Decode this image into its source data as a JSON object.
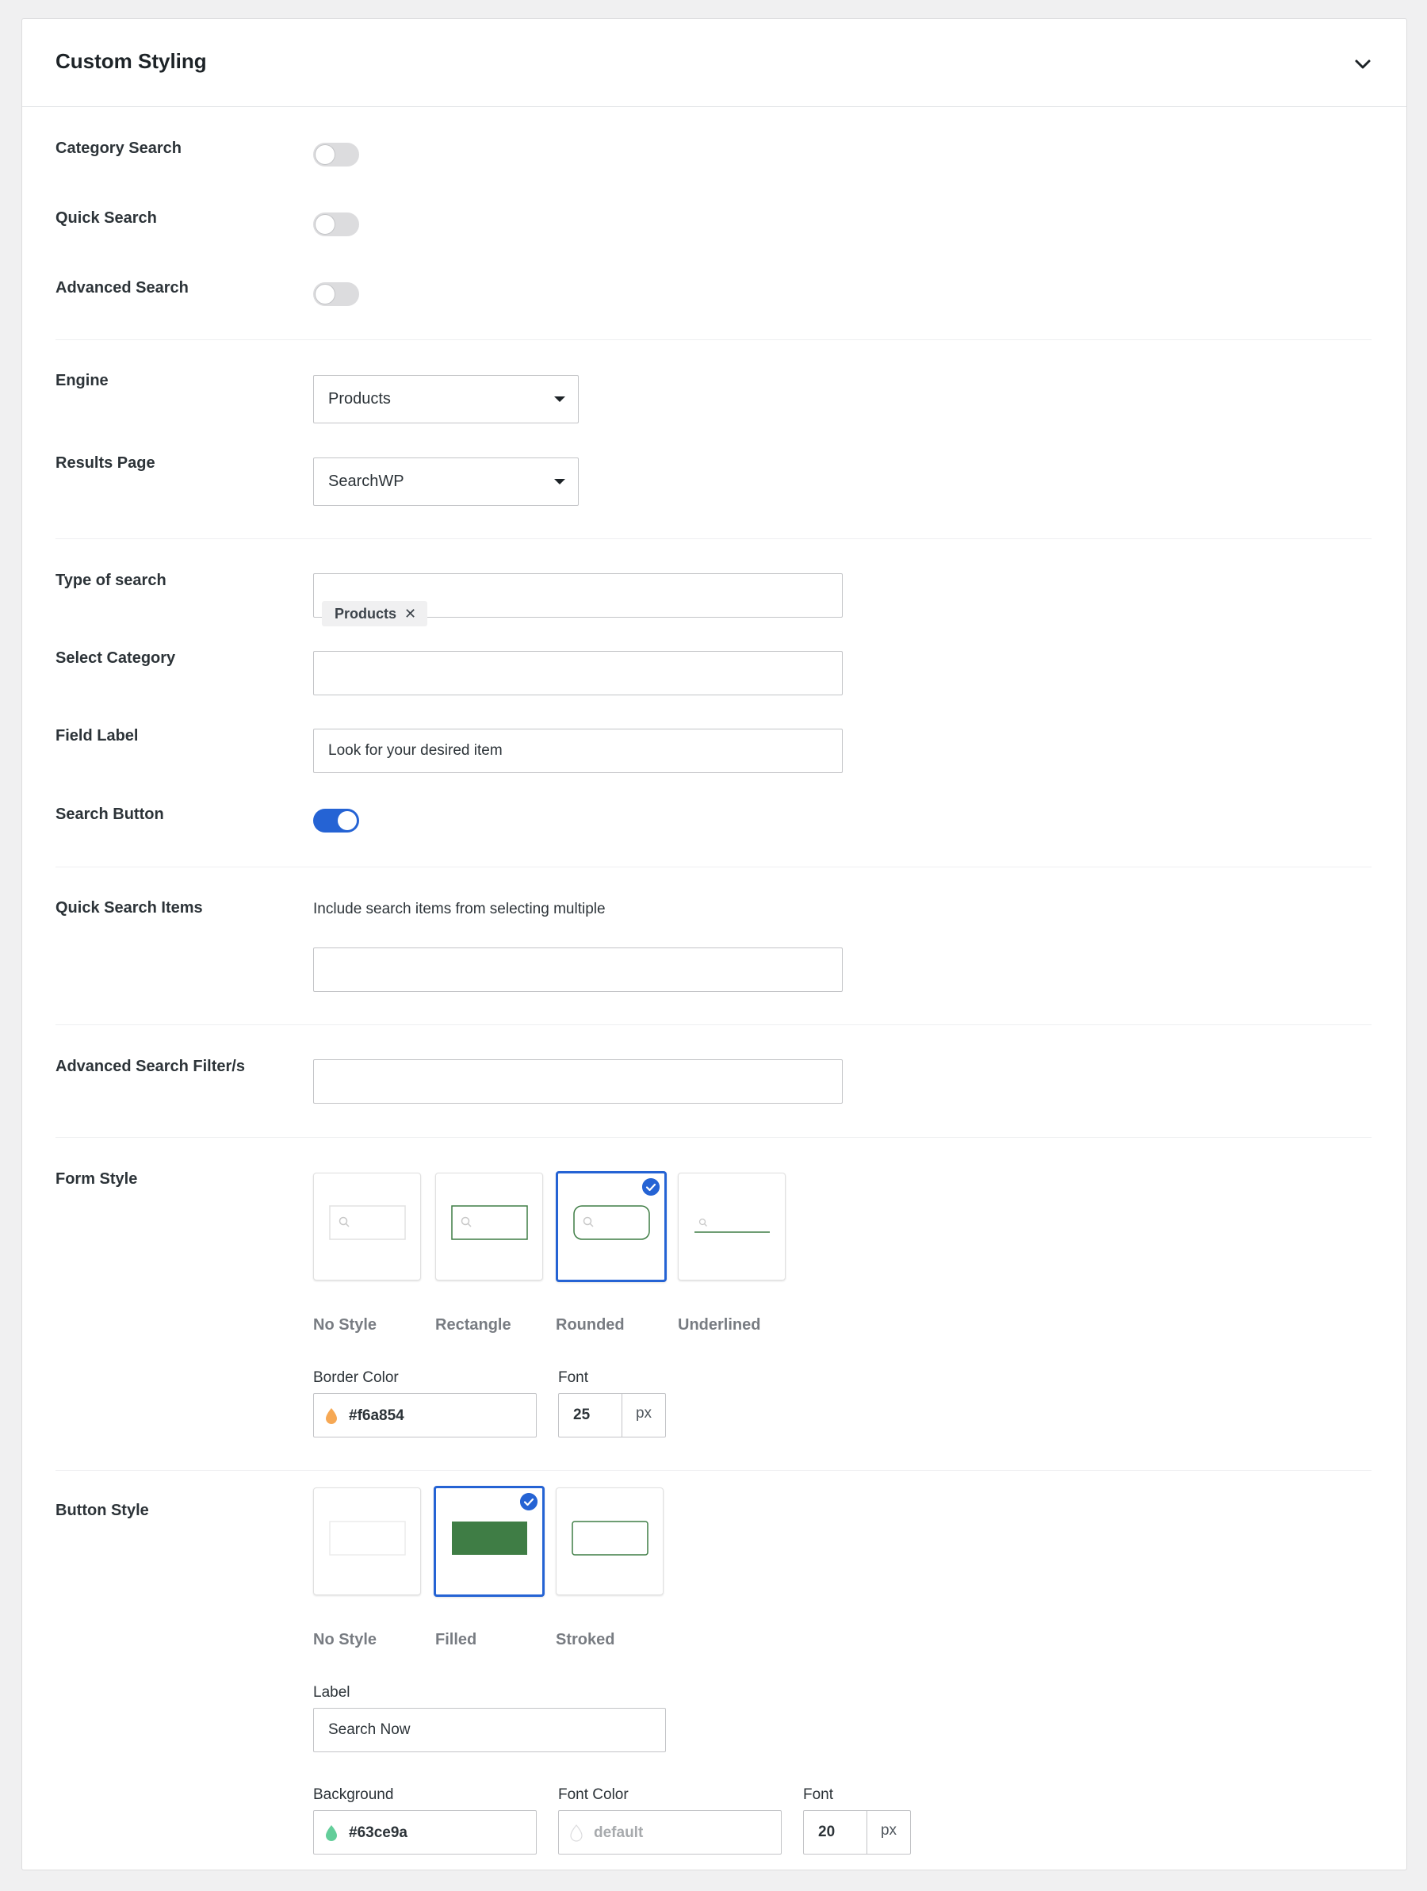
{
  "panel": {
    "title": "Custom Styling"
  },
  "toggles": {
    "category_search": {
      "label": "Category Search",
      "on": false
    },
    "quick_search": {
      "label": "Quick Search",
      "on": false
    },
    "advanced_search": {
      "label": "Advanced Search",
      "on": false
    }
  },
  "engine": {
    "label": "Engine",
    "value": "Products"
  },
  "results_page": {
    "label": "Results Page",
    "value": "SearchWP"
  },
  "type_of_search": {
    "label": "Type of search",
    "chips": [
      "Products"
    ]
  },
  "select_category": {
    "label": "Select Category",
    "value": ""
  },
  "field_label": {
    "label": "Field Label",
    "value": "Look for your desired item"
  },
  "search_button": {
    "label": "Search Button",
    "on": true
  },
  "quick_search_items": {
    "label": "Quick Search Items",
    "description": "Include search items from selecting multiple",
    "value": ""
  },
  "advanced_filters": {
    "label": "Advanced Search Filter/s",
    "value": ""
  },
  "form_style": {
    "label": "Form Style",
    "options": [
      "No Style",
      "Rectangle",
      "Rounded",
      "Underlined"
    ],
    "selected": "Rounded",
    "border_color_label": "Border Color",
    "border_color": "#f6a854",
    "font_label": "Font",
    "font_size": "25",
    "unit": "px"
  },
  "button_style": {
    "label": "Button Style",
    "options": [
      "No Style",
      "Filled",
      "Stroked"
    ],
    "selected": "Filled",
    "label_field_label": "Label",
    "label_value": "Search Now",
    "background_label": "Background",
    "background": "#63ce9a",
    "font_color_label": "Font Color",
    "font_color": "default",
    "font_label": "Font",
    "font_size": "20",
    "unit": "px"
  },
  "colors": {
    "accent": "#2563d4",
    "preview_green": "#3f7d45"
  }
}
